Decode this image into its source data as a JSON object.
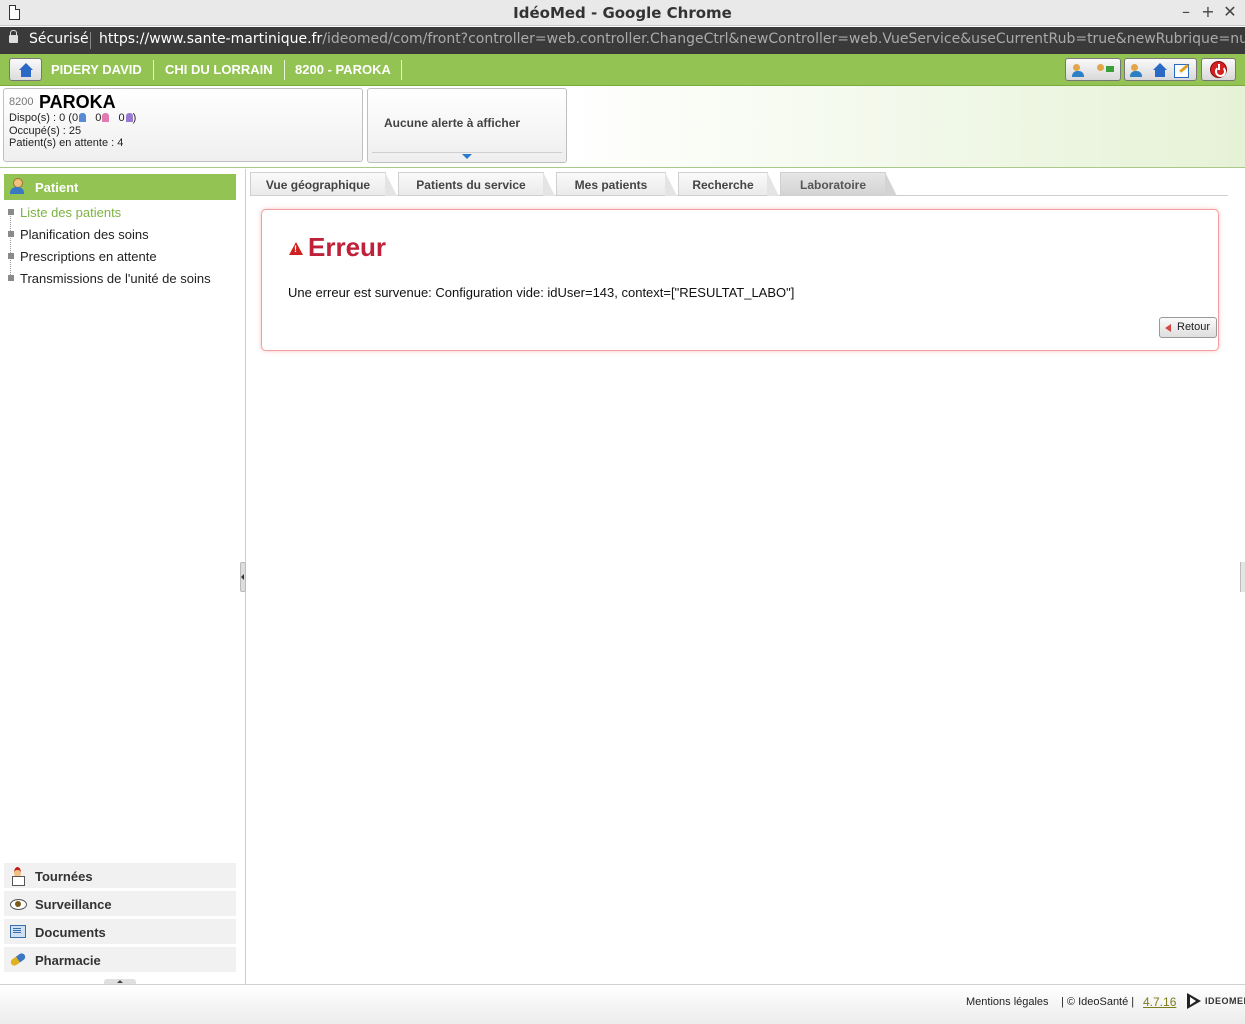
{
  "window": {
    "title": "IdéoMed - Google Chrome",
    "buttons": {
      "minimize": "–",
      "maximize": "+",
      "close": "✕"
    }
  },
  "address_bar": {
    "secure_label": "Sécurisé",
    "url_scheme": "https://",
    "url_host": "www.sante-martinique.fr",
    "url_path": "/ideomed/com/front?controller=web.controller.ChangeCtrl&newController=web.VueService&useCurrentRub=true&newRubrique=null"
  },
  "top_nav": {
    "user": "PIDERY DAVID",
    "hospital": "CHI DU LORRAIN",
    "service": "8200 - PAROKA"
  },
  "unit": {
    "code": "8200",
    "name": "PAROKA",
    "dispo_prefix": "Dispo(s) : 0 (0",
    "dispo_male": "0",
    "dispo_female": "0",
    "dispo_suffix": ")",
    "occupied": "Occupé(s) : 25",
    "waiting": "Patient(s) en attente : 4"
  },
  "alerts": {
    "text": "Aucune alerte à afficher"
  },
  "sidebar": {
    "active_section": "Patient",
    "menu": [
      {
        "label": "Liste des patients"
      },
      {
        "label": "Planification des soins"
      },
      {
        "label": "Prescriptions en attente"
      },
      {
        "label": "Transmissions de l'unité de soins"
      }
    ],
    "sections": [
      {
        "label": "Tournées",
        "icon": "nurse-icon"
      },
      {
        "label": "Surveillance",
        "icon": "eye-icon"
      },
      {
        "label": "Documents",
        "icon": "document-icon"
      },
      {
        "label": "Pharmacie",
        "icon": "pill-icon"
      }
    ]
  },
  "tabs": [
    {
      "label": "Vue géographique"
    },
    {
      "label": "Patients du service"
    },
    {
      "label": "Mes patients"
    },
    {
      "label": "Recherche"
    },
    {
      "label": "Laboratoire",
      "active": true
    }
  ],
  "error": {
    "title": "Erreur",
    "message": "Une erreur est survenue: Configuration vide: idUser=143, context=[\"RESULTAT_LABO\"]",
    "back_label": "Retour"
  },
  "footer": {
    "legal": "Mentions légales",
    "copyright": "| © IdeoSanté |",
    "version": "4.7.16",
    "logo_text": "IDEOMED"
  },
  "colors": {
    "brand_green": "#92c353",
    "error_red": "#c0213a",
    "active_link": "#7cb342"
  }
}
